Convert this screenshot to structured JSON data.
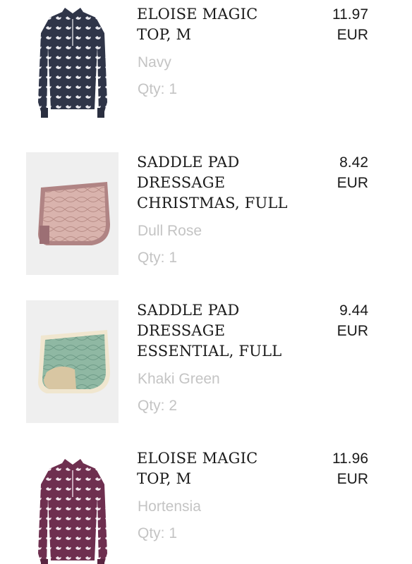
{
  "cart_items": [
    {
      "title": "ELOISE MAGIC\nTOP, M",
      "variant": "Navy",
      "qty": "Qty: 1",
      "price_amount": "11.97",
      "price_currency": "EUR",
      "image": "shirt-icon",
      "color": "#2f3548"
    },
    {
      "title": "SADDLE PAD\nDRESSAGE\nCHRISTMAS, FULL",
      "variant": "Dull Rose",
      "qty": "Qty: 1",
      "price_amount": "8.42",
      "price_currency": "EUR",
      "image": "saddle-pad-icon",
      "color": "#d9b3ad"
    },
    {
      "title": "SADDLE PAD\nDRESSAGE\nESSENTIAL, FULL",
      "variant": "Khaki Green",
      "qty": "Qty: 2",
      "price_amount": "9.44",
      "price_currency": "EUR",
      "image": "saddle-pad-icon",
      "color": "#8fb8a3"
    },
    {
      "title": "ELOISE MAGIC\nTOP, M",
      "variant": "Hortensia",
      "qty": "Qty: 1",
      "price_amount": "11.96",
      "price_currency": "EUR",
      "image": "shirt-icon",
      "color": "#6e2f4f"
    }
  ]
}
